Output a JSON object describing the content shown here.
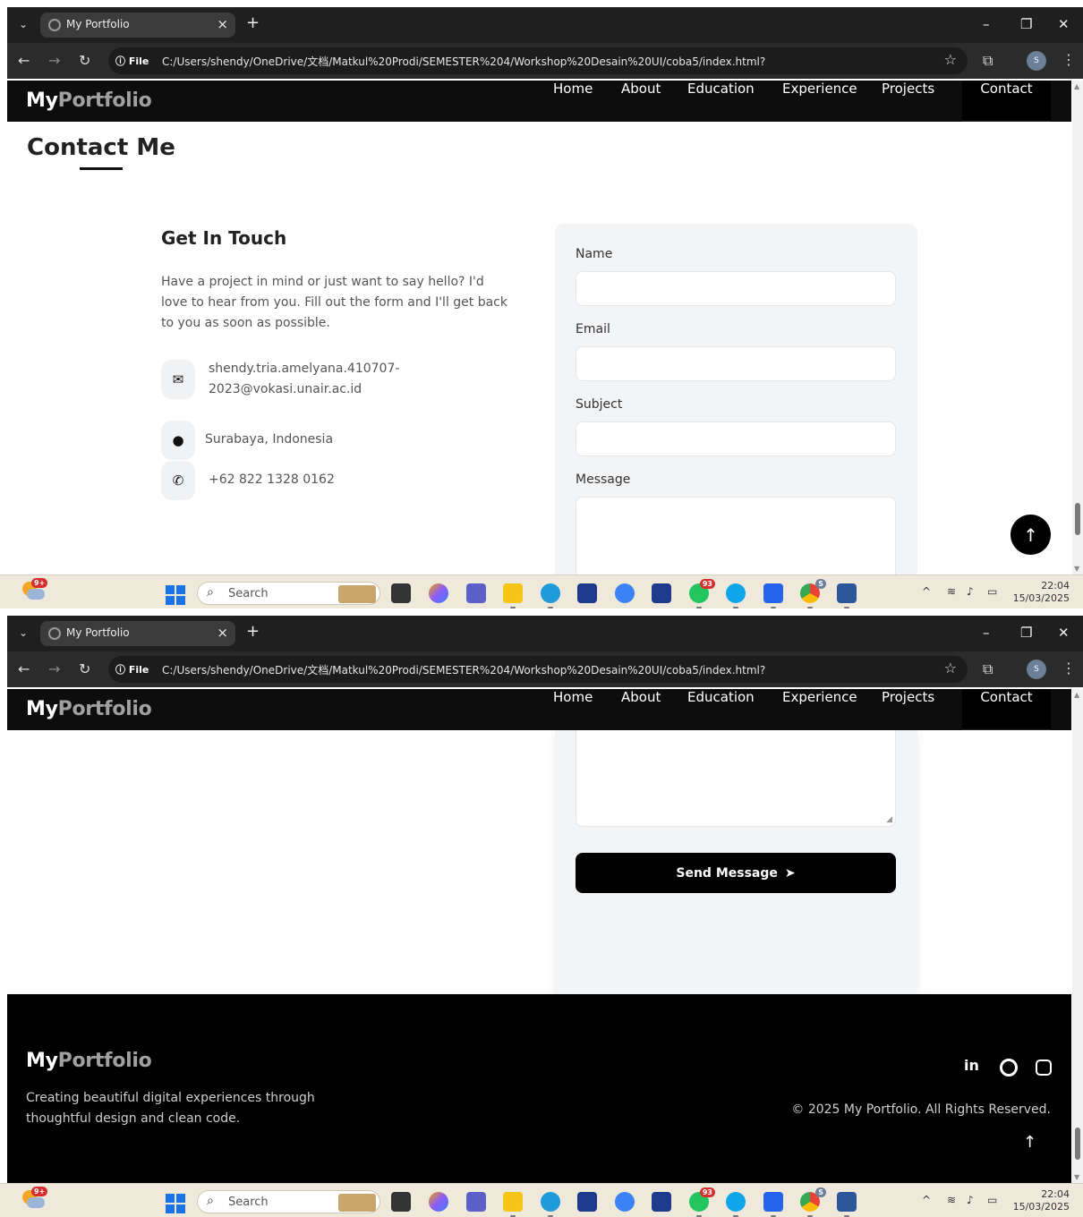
{
  "browser": {
    "tab_title": "My Portfolio",
    "tab_close": "×",
    "new_tab": "+",
    "file_label": "ⓘ File",
    "url": "C:/Users/shendy/OneDrive/文档/Matkul%20Prodi/SEMESTER%204/Workshop%20Desain%20UI/coba5/index.html?",
    "profile_initial": "S"
  },
  "header": {
    "logo_main": "My",
    "logo_accent": "Portfolio",
    "nav": [
      "Home",
      "About",
      "Education",
      "Experience",
      "Projects",
      "Contact"
    ],
    "active": "Contact"
  },
  "contact": {
    "section_title": "Contact Me",
    "get_in_touch": "Get In Touch",
    "intro": "Have a project in mind or just want to say hello? I'd love to hear from you. Fill out the form and I'll get back to you as soon as possible.",
    "email_line1": "shendy.tria.amelyana.410707-",
    "email_line2": "2023@vokasi.unair.ac.id",
    "location": "Surabaya, Indonesia",
    "phone": "+62 822 1328 0162"
  },
  "form": {
    "name_label": "Name",
    "email_label": "Email",
    "subject_label": "Subject",
    "message_label": "Message",
    "send_label": "Send Message"
  },
  "footer": {
    "logo_main": "My",
    "logo_accent": "Portfolio",
    "tagline": "Creating beautiful digital experiences through thoughtful design and clean code.",
    "social": [
      "in",
      "github",
      "instagram"
    ],
    "copyright": "© 2025 My Portfolio. All Rights Reserved."
  },
  "taskbar": {
    "weather_badge": "9+",
    "search_placeholder": "Search",
    "whatsapp_badge": "93",
    "chrome_badge": "S",
    "time": "22:04",
    "date": "15/03/2025"
  },
  "colors": {
    "header_bg": "#0d0d0d",
    "logo_accent": "#a0a0a0",
    "form_bg": "#f3f4f6",
    "button_bg": "#000000",
    "taskbar_bg": "#efe9dc"
  }
}
